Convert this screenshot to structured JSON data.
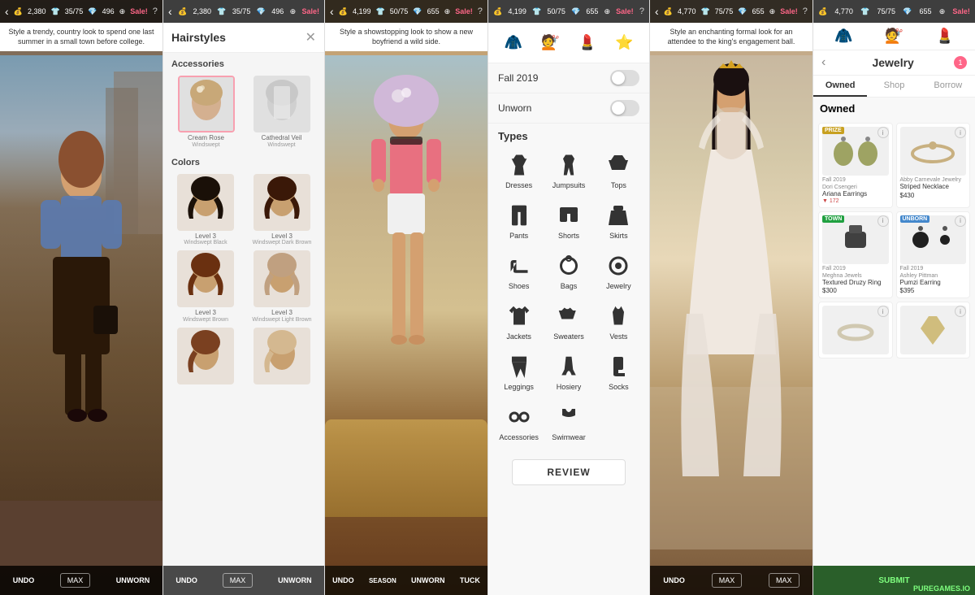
{
  "panel1": {
    "status": {
      "coins": "2,380",
      "items": "35/75",
      "diamonds": "496",
      "sale": "Sale!",
      "help": "?"
    },
    "subtitle": "Style a trendy, country look to spend one last summer in a small town before college.",
    "bottom_buttons": [
      "UNDO",
      "MAX",
      "UNWORN"
    ]
  },
  "panel2": {
    "title": "Hairstyles",
    "section_accessories": "Accessories",
    "section_colors": "Colors",
    "accessories": [
      {
        "label": "Cream Rose",
        "sublabel": "Windswept"
      },
      {
        "label": "Cathedral Veil",
        "sublabel": "Windswept"
      }
    ],
    "colors": [
      {
        "label": "Level 3",
        "sublabel": "Windswept Black",
        "bg": "#1a1008"
      },
      {
        "label": "Level 3",
        "sublabel": "Windswept Dark Brown",
        "bg": "#3a1808"
      },
      {
        "label": "Level 3",
        "sublabel": "Windswept Brown",
        "bg": "#6a3010"
      },
      {
        "label": "Level 3",
        "sublabel": "Windswept Light Brown",
        "bg": "#b0a090"
      },
      {
        "label": "",
        "sublabel": "",
        "bg": "#6a3818"
      },
      {
        "label": "",
        "sublabel": "",
        "bg": "#c8a878"
      }
    ]
  },
  "panel3": {
    "status": {
      "coins": "4,199",
      "items": "50/75",
      "diamonds": "655",
      "sale": "Sale!",
      "help": "?"
    },
    "subtitle": "Style a showstopping look to show a new boyfriend a wild side.",
    "bottom_buttons": [
      "UNDO",
      "SEASON",
      "UNWORN",
      "TUCK"
    ]
  },
  "panel4": {
    "filter_fall": "Fall 2019",
    "filter_unworn": "Unworn",
    "types_label": "Types",
    "types": [
      {
        "name": "Dresses",
        "icon": "dress"
      },
      {
        "name": "Jumpsuits",
        "icon": "jumpsuit"
      },
      {
        "name": "Tops",
        "icon": "top"
      },
      {
        "name": "Pants",
        "icon": "pants"
      },
      {
        "name": "Shorts",
        "icon": "shorts"
      },
      {
        "name": "Skirts",
        "icon": "skirt"
      },
      {
        "name": "Shoes",
        "icon": "shoes"
      },
      {
        "name": "Bags",
        "icon": "bag"
      },
      {
        "name": "Jewelry",
        "icon": "jewelry"
      },
      {
        "name": "Jackets",
        "icon": "jacket"
      },
      {
        "name": "Sweaters",
        "icon": "sweater"
      },
      {
        "name": "Vests",
        "icon": "vest"
      },
      {
        "name": "Leggings",
        "icon": "leggings"
      },
      {
        "name": "Hosiery",
        "icon": "hosiery"
      },
      {
        "name": "Socks",
        "icon": "socks"
      },
      {
        "name": "Accessories",
        "icon": "accessories"
      },
      {
        "name": "Swimwear",
        "icon": "swimwear"
      }
    ],
    "review_label": "REVIEW"
  },
  "panel5": {
    "status": {
      "coins": "4,770",
      "items": "75/75",
      "diamonds": "655",
      "sale": "Sale!",
      "help": "?"
    },
    "subtitle": "Style an enchanting formal look for an attendee to the king's engagement ball.",
    "bottom_buttons": [
      "UNDO",
      "MAX",
      "MAX"
    ]
  },
  "panel6": {
    "title": "Jewelry",
    "badge_count": "1",
    "tabs": [
      "Owned",
      "Shop",
      "Borrow"
    ],
    "owned_label": "Owned",
    "items": [
      {
        "badge": "PRIZE",
        "badge_type": "prize",
        "season": "Fall 2019",
        "designer": "Dori Csengeri",
        "name": "Ariana Earrings",
        "rating": "▼ 172",
        "img_color": "#b8a060"
      },
      {
        "badge": "",
        "badge_type": "",
        "season": "",
        "designer": "Abby Carnevale Jewelry",
        "name": "Striped Necklace",
        "price": "$430",
        "img_color": "#d4c090"
      },
      {
        "badge": "TOWN",
        "badge_type": "town",
        "season": "Fall 2019",
        "designer": "Meghna Jewels",
        "name": "Textured Druzy Ring",
        "price": "$300",
        "img_color": "#404040"
      },
      {
        "badge": "UNBORN",
        "badge_type": "unborn",
        "season": "Fall 2019",
        "designer": "Ashley Pittman",
        "name": "Pumzi Earring",
        "price": "$395",
        "img_color": "#202020"
      },
      {
        "badge": "",
        "badge_type": "",
        "season": "",
        "designer": "",
        "name": "",
        "price": "",
        "img_color": "#e0d8c8"
      },
      {
        "badge": "",
        "badge_type": "",
        "season": "",
        "designer": "",
        "name": "",
        "price": "",
        "img_color": "#c8b870"
      }
    ],
    "submit_label": "SUBMIT",
    "watermark": "PUREGAMES.IO"
  }
}
